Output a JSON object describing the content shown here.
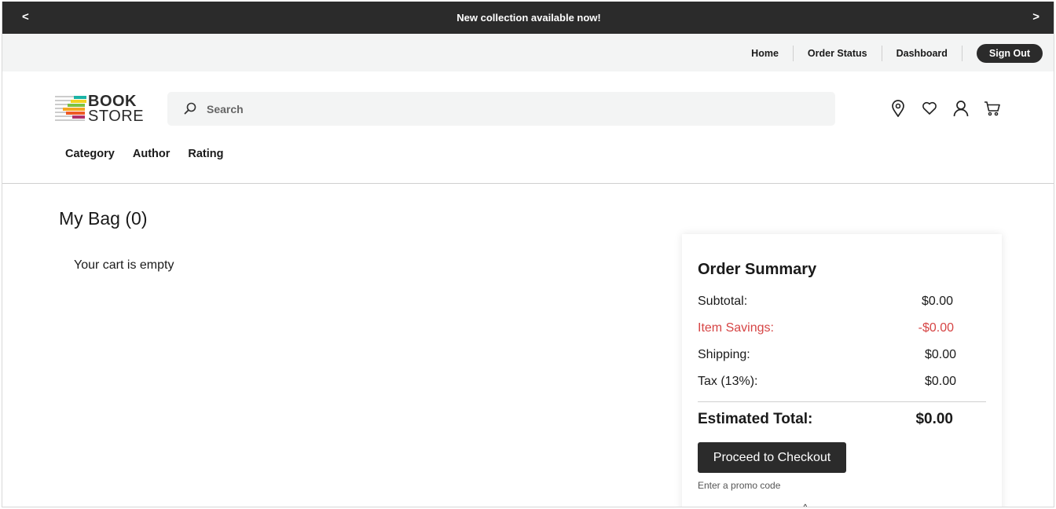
{
  "announcement": {
    "prev_label": "<",
    "message": "New collection available now!",
    "next_label": ">"
  },
  "utility_nav": {
    "links": [
      "Home",
      "Order Status",
      "Dashboard"
    ],
    "sign_out_label": "Sign Out"
  },
  "header": {
    "logo": {
      "line1": "BOOK",
      "line2": "STORE"
    },
    "search": {
      "placeholder": "Search",
      "value": ""
    },
    "icons": [
      "location-pin-icon",
      "heart-icon",
      "user-icon",
      "cart-icon"
    ]
  },
  "category_nav": [
    "Category",
    "Author",
    "Rating"
  ],
  "bag": {
    "title": "My Bag (0)",
    "empty_message": "Your cart is empty"
  },
  "order_summary": {
    "title": "Order Summary",
    "subtotal": {
      "label": "Subtotal:",
      "value": "$0.00"
    },
    "savings": {
      "label": "Item Savings:",
      "value": "-$0.00"
    },
    "shipping": {
      "label": "Shipping:",
      "value": "$0.00"
    },
    "tax": {
      "label": "Tax (13%):",
      "value": "$0.00"
    },
    "total": {
      "label": "Estimated Total:",
      "value": "$0.00"
    },
    "checkout_label": "Proceed to Checkout",
    "promo_label": "Enter a promo code",
    "promo_toggle": "^"
  },
  "colors": {
    "dark": "#2b2b2b",
    "light_bg": "#f3f4f4",
    "savings_red": "#d64545"
  }
}
